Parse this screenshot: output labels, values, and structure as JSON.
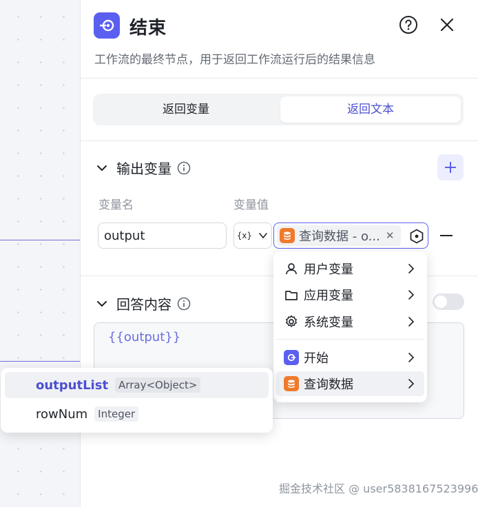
{
  "panel": {
    "title": "结束",
    "description": "工作流的最终节点，用于返回工作流运行后的结果信息",
    "node_icon": "end-node-icon",
    "help_icon": "help-circle-icon",
    "close_icon": "close-icon"
  },
  "tabs": [
    {
      "label": "返回变量",
      "active": false
    },
    {
      "label": "返回文本",
      "active": true
    }
  ],
  "output_section": {
    "title": "输出变量",
    "col_name": "变量名",
    "col_value": "变量值",
    "rows": [
      {
        "name": "output",
        "type_icon": "{x}",
        "value": "查询数据 - o..."
      }
    ]
  },
  "answer_section": {
    "title": "回答内容",
    "toggle_on": false,
    "content": "{{output}}"
  },
  "variable_menu": {
    "items": [
      {
        "label": "用户变量",
        "icon": "user-icon"
      },
      {
        "label": "应用变量",
        "icon": "folder-icon"
      },
      {
        "label": "系统变量",
        "icon": "gear-icon"
      },
      {
        "label": "开始",
        "icon": "start-node-icon"
      },
      {
        "label": "查询数据",
        "icon": "database-node-icon",
        "active": true
      }
    ]
  },
  "field_menu": {
    "items": [
      {
        "name": "outputList",
        "type": "Array<Object>",
        "active": true
      },
      {
        "name": "rowNum",
        "type": "Integer",
        "active": false
      }
    ]
  },
  "watermark": "掘金技术社区 @ user5838167523996",
  "colors": {
    "accent": "#5b5ff0",
    "accent_text": "#4b4fd1",
    "db_orange": "#f07a2a"
  }
}
